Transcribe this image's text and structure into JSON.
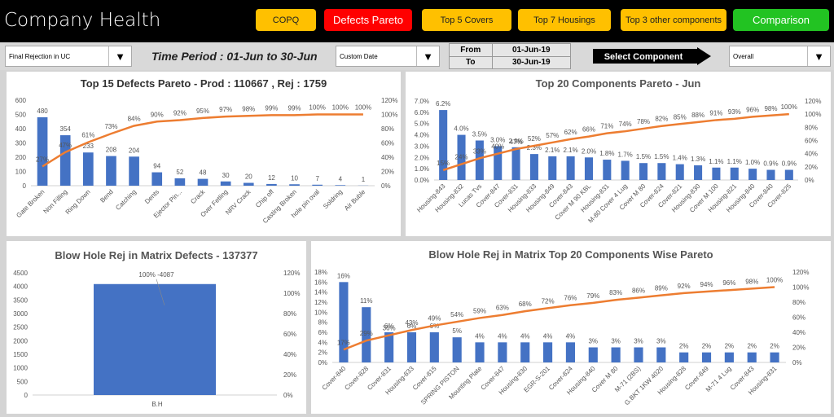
{
  "header": {
    "title": "Company Health",
    "buttons": [
      {
        "label": "COPQ",
        "color": "#ffc000"
      },
      {
        "label": "Defects Pareto",
        "color": "#ff0000"
      },
      {
        "label": "Top 5 Covers",
        "color": "#ffc000"
      },
      {
        "label": "Top 7 Housings",
        "color": "#ffc000"
      },
      {
        "label": "Top 3 other components",
        "color": "#ffc000"
      },
      {
        "label": "Comparison",
        "color": "#22c322"
      }
    ]
  },
  "toolbar": {
    "rejection_type": "Final Rejection in UC",
    "time_period": "Time Period : 01-Jun to 30-Jun",
    "date_mode": "Custom Date",
    "from_label": "From",
    "from_value": "01-Jun-19",
    "to_label": "To",
    "to_value": "30-Jun-19",
    "select_component": "Select Component",
    "component": "Overall"
  },
  "colors": {
    "bar": "#4472c4",
    "line": "#ed7d31"
  },
  "chart_data": [
    {
      "type": "bar+line",
      "title": "Top 15 Defects Pareto - Prod : 110667 , Rej : 1759",
      "categories": [
        "Gate Broken",
        "Non Filling",
        "Ring Down",
        "Bend",
        "Catching",
        "Dents",
        "Ejector Pin...",
        "Crack",
        "Over Fetling",
        "NRV Crack",
        "Chip off",
        "Casting Broken",
        "hole pin oval",
        "Soldring",
        "Air Buble"
      ],
      "values": [
        480,
        354,
        233,
        208,
        204,
        94,
        52,
        48,
        30,
        20,
        12,
        10,
        7,
        4,
        1
      ],
      "cumulative_pct": [
        27,
        47,
        61,
        73,
        84,
        90,
        92,
        95,
        97,
        98,
        99,
        99,
        100,
        100,
        100
      ],
      "ylim": [
        0,
        600
      ],
      "yticks": [
        0,
        100,
        200,
        300,
        400,
        500,
        600
      ],
      "y2lim": [
        0,
        120
      ],
      "y2ticks": [
        0,
        20,
        40,
        60,
        80,
        100,
        120
      ]
    },
    {
      "type": "bar+line",
      "title": "Top 20 Components Pareto - Jun",
      "categories": [
        "Housing-843",
        "Housing-832",
        "Lucas Tvs",
        "Cover-847",
        "Cover-831",
        "Housing-833",
        "Housing-849",
        "Cover-843",
        "Cover M 90 KBL",
        "Housing-831",
        "M-80 Cover 4 Lug",
        "Cover M 80",
        "Cover-824",
        "Cover-821",
        "Housing-830",
        "Cover M 100",
        "Housing-821",
        "Housing-840",
        "Cover-840",
        "Cover-825"
      ],
      "values": [
        6.2,
        4.0,
        3.5,
        3.0,
        2.9,
        2.3,
        2.1,
        2.1,
        2.0,
        1.8,
        1.7,
        1.5,
        1.5,
        1.4,
        1.3,
        1.1,
        1.1,
        1.0,
        0.9,
        0.9
      ],
      "cumulative_pct": [
        15,
        24,
        33,
        40,
        47,
        52,
        57,
        62,
        66,
        71,
        74,
        78,
        82,
        85,
        88,
        91,
        93,
        96,
        98,
        100
      ],
      "ylim": [
        0,
        7
      ],
      "yticks": [
        0,
        1,
        2,
        3,
        4,
        5,
        6,
        7
      ],
      "y_unit": "%",
      "y_decimals": 1,
      "y2lim": [
        0,
        120
      ],
      "y2ticks": [
        0,
        20,
        40,
        60,
        80,
        100,
        120
      ]
    },
    {
      "type": "bar+line",
      "title": "Blow Hole Rej in Matrix Defects - 137377",
      "categories": [
        "B.H"
      ],
      "values": [
        4087
      ],
      "cumulative_pct": [
        100
      ],
      "ylim": [
        0,
        4500
      ],
      "yticks": [
        0,
        500,
        1000,
        1500,
        2000,
        2500,
        3000,
        3500,
        4000,
        4500
      ],
      "y2lim": [
        0,
        120
      ],
      "y2ticks": [
        0,
        20,
        40,
        60,
        80,
        100,
        120
      ]
    },
    {
      "type": "bar+line",
      "title": "Blow Hole Rej in Matrix Top 20 Components Wise Pareto",
      "categories": [
        "Cover-840",
        "Cover-828",
        "Cover-831",
        "Housing-833",
        "Cover-815",
        "SPRING PISTON",
        "Mounting Plate",
        "Cover-847",
        "Housing-830",
        "EGR-S-201",
        "Cover-824",
        "Housing-840",
        "Cover M 80",
        "M-71 (2BS)",
        "G.BKT 1KW 4020",
        "Housing-828",
        "Cover-849",
        "M-71 4 Lug",
        "Cover-843",
        "Housing-831"
      ],
      "values": [
        16,
        11,
        6,
        6,
        6,
        5,
        4,
        4,
        4,
        4,
        4,
        3,
        3,
        3,
        3,
        2,
        2,
        2,
        2,
        2
      ],
      "cumulative_pct": [
        17,
        29,
        36,
        43,
        49,
        54,
        59,
        63,
        68,
        72,
        76,
        79,
        83,
        86,
        89,
        92,
        94,
        96,
        98,
        100
      ],
      "ylim": [
        0,
        18
      ],
      "yticks": [
        0,
        2,
        4,
        6,
        8,
        10,
        12,
        14,
        16,
        18
      ],
      "y_unit": "%",
      "y2lim": [
        0,
        120
      ],
      "y2ticks": [
        0,
        20,
        40,
        60,
        80,
        100,
        120
      ]
    }
  ]
}
